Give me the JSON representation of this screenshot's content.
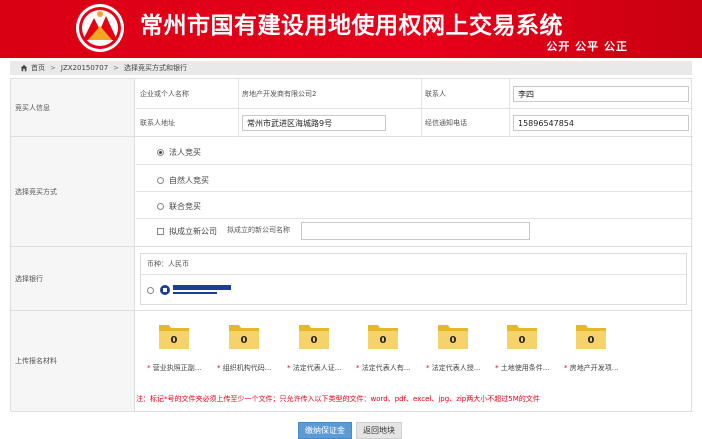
{
  "header": {
    "title": "常州市国有建设用地使用权网上交易系统",
    "slogan": "公开 公平 公正",
    "colors": {
      "brand": "#e60012",
      "primary_button": "#5b9bd5"
    }
  },
  "breadcrumb": {
    "home_icon": "home-icon",
    "home": "首页",
    "parcel": "JZX20150707",
    "current": "选择竞买方式和银行"
  },
  "bidder_info": {
    "section_label": "竞买人信息",
    "company_label": "企业或个人名称",
    "company_value": "房地产开发商有限公司2",
    "contact_label": "联系人",
    "contact_value": "李四",
    "address_label": "联系人地址",
    "address_value": "常州市武进区海城路9号",
    "phone_label": "经信通知电话",
    "phone_value": "15896547854"
  },
  "bid_method": {
    "section_label": "选择竞买方式",
    "options": [
      "法人竞买",
      "自然人竞买",
      "联合竞买"
    ],
    "selected": "法人竞买",
    "new_company_checkbox": "拟成立新公司",
    "new_company_name_label": "拟成立的新公司名称",
    "new_company_name_value": ""
  },
  "bank": {
    "section_label": "选择银行",
    "currency_text": "币种：人民币",
    "bank_logo_alt": "中国建设银行"
  },
  "upload": {
    "section_label": "上传报名材料",
    "folder_count": "0",
    "required_mark": "*",
    "items": [
      "营业执照正副...",
      "组织机构代码...",
      "法定代表人证...",
      "法定代表人有...",
      "法定代表人授...",
      "土地使用条件...",
      "房地产开发项..."
    ],
    "note": "注：标记*号的文件夹必须上传至少一个文件；只允许传入以下类型的文件：word、pdf、excel、jpg、zip两大小不超过5M的文件"
  },
  "actions": {
    "pay_deposit": "缴纳保证金",
    "back": "返回地块"
  }
}
